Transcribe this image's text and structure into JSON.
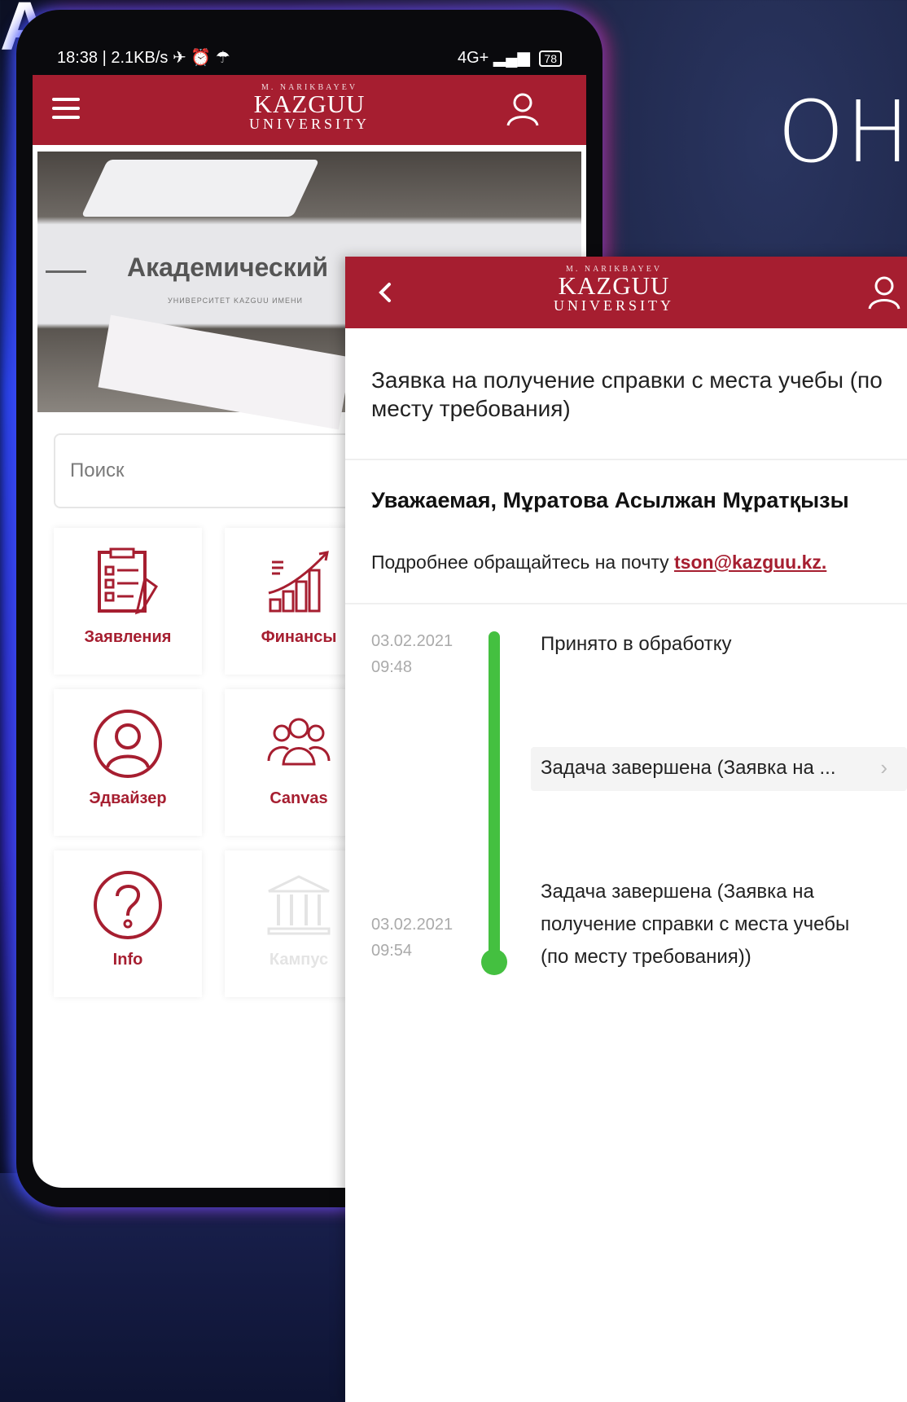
{
  "hero": {
    "letter": "A",
    "headline": "ОН"
  },
  "statusbar": {
    "left": "18:38 | 2.1KB/s ✈ ⏰ ☂",
    "battery": "78",
    "signal": "4G+ ▂▄▆"
  },
  "home_app": {
    "logo": {
      "line1": "M. NARIKBAYEV",
      "line2": "KAZGUU",
      "line3": "UNIVERSITY"
    },
    "banner": {
      "title": "Академический",
      "subtitle": "УНИВЕРСИТЕТ KAZGUU ИМЕНИ"
    },
    "search": {
      "placeholder": "Поиск"
    },
    "tiles": [
      {
        "label": "Заявления",
        "icon": "document-checklist-icon"
      },
      {
        "label": "Финансы",
        "icon": "finance-chart-icon"
      },
      {
        "label": "Эдвайзер",
        "icon": "advisor-person-icon"
      },
      {
        "label": "Canvas",
        "icon": "group-people-icon"
      },
      {
        "label": "Info",
        "icon": "question-circle-icon"
      },
      {
        "label": "Кампус",
        "icon": "campus-building-icon"
      }
    ]
  },
  "detail": {
    "logo": {
      "line1": "M. NARIKBAYEV",
      "line2": "KAZGUU",
      "line3": "UNIVERSITY"
    },
    "title": "Заявка на получение справки с места учебы (по месту требования)",
    "greeting": "Уважаемая, Мұратова Асылжан Мұратқызы",
    "info_prefix": "Подробнее обращайтесь на почту ",
    "email": "tson@kazguu.kz.",
    "timeline": [
      {
        "date": "03.02.2021",
        "time": "09:48",
        "text": "Принято в обработку"
      },
      {
        "task_text": "Задача завершена (Заявка на ...",
        "chevron": "›"
      },
      {
        "date": "03.02.2021",
        "time": "09:54",
        "text": "Задача завершена (Заявка на получение справки с места учебы (по месту требования))"
      }
    ],
    "colors": {
      "brand": "#a61e30",
      "timeline": "#44c040"
    }
  }
}
